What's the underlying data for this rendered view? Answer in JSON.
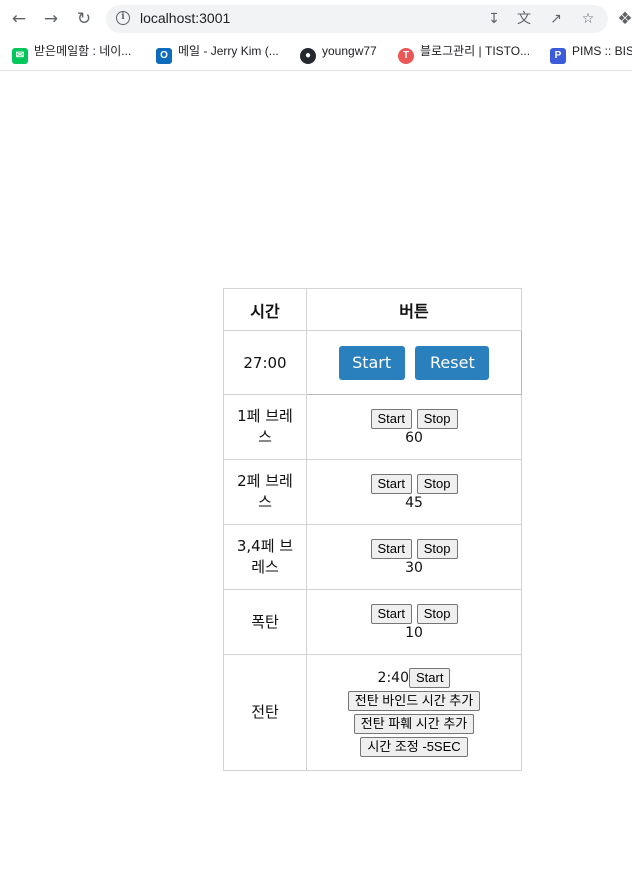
{
  "browser": {
    "url": "localhost:3001",
    "bookmarks": [
      {
        "label": "받은메일함 : 네이...",
        "color": "#03c75a"
      },
      {
        "label": "메일 - Jerry Kim (...",
        "color": "#0f6cbd"
      },
      {
        "label": "youngw77",
        "color": "#24292f"
      },
      {
        "label": "블로그관리 | TISTO...",
        "color": "#eb5757"
      },
      {
        "label": "PIMS :: BIS",
        "color": "#3b5bdb"
      }
    ]
  },
  "table": {
    "header_time": "시간",
    "header_buttons": "버튼",
    "main": {
      "time": "27:00",
      "start_label": "Start",
      "reset_label": "Reset"
    },
    "rows": [
      {
        "label": "1페 브레스",
        "value": "60",
        "start": "Start",
        "stop": "Stop"
      },
      {
        "label": "2페 브레스",
        "value": "45",
        "start": "Start",
        "stop": "Stop"
      },
      {
        "label": "3,4페 브레스",
        "value": "30",
        "start": "Start",
        "stop": "Stop"
      },
      {
        "label": "폭탄",
        "value": "10",
        "start": "Start",
        "stop": "Stop"
      }
    ],
    "last": {
      "label": "전탄",
      "time": "2:40",
      "start": "Start",
      "btn_bind": "전탄 바인드 시간 추가",
      "btn_break": "전탄 파훼 시간 추가",
      "btn_adjust": "시간 조정 -5SEC"
    }
  }
}
